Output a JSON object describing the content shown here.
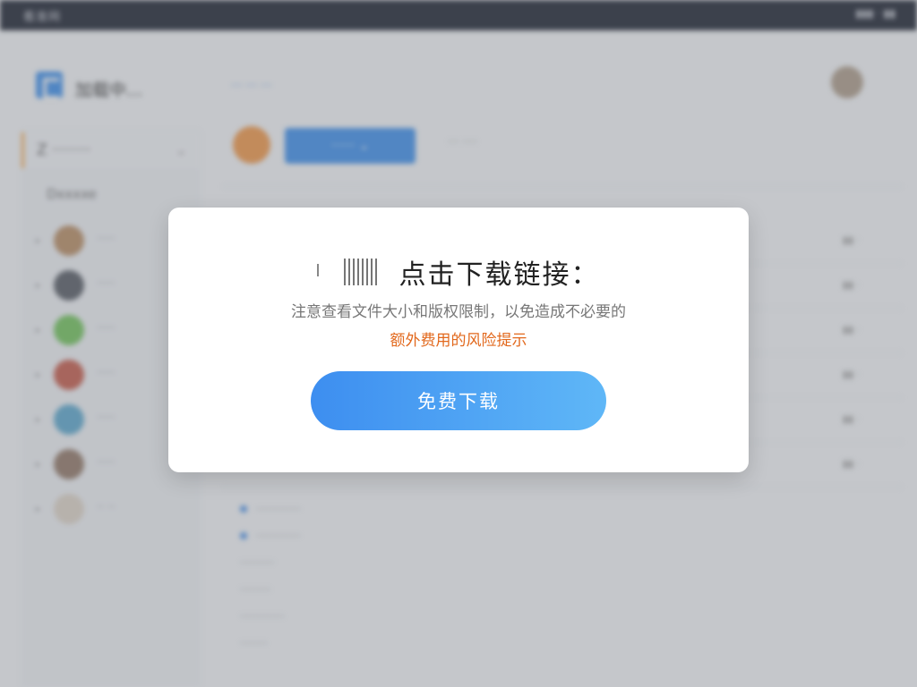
{
  "background": {
    "topbar": {
      "brand": "看准网",
      "right": "▮▮▮ · ▮▮"
    },
    "header": {
      "team_name": "加载中...",
      "link": "··· ··· ···"
    },
    "workspace": {
      "label": "Z ········",
      "chevron": "⌄"
    },
    "sidebar_section": "Dxxxxe",
    "members": [
      {
        "name": "·····",
        "color": "#b48a62"
      },
      {
        "name": "·····",
        "color": "#555a63"
      },
      {
        "name": "·····",
        "color": "#6fbf5a"
      },
      {
        "name": "·····",
        "color": "#c15a4a"
      },
      {
        "name": "·····",
        "color": "#5aa4c9"
      },
      {
        "name": "·····",
        "color": "#8f7666"
      },
      {
        "name": "·· ··",
        "color": "#d9d0c4"
      }
    ],
    "main": {
      "primary_button": "······ ⌄",
      "search_hint": "··· ····",
      "rows": [
        "▮▮ ·",
        "▮▮ ·",
        "▮▮ ·",
        "▮▮ ·",
        "▮▮ ·",
        "▮▮ ·"
      ],
      "lower_rows": [
        "·············",
        "·············",
        "··········",
        "·········",
        "·············",
        "········"
      ]
    }
  },
  "modal": {
    "title": "点击下载链接：",
    "description": "注意查看文件大小和版权限制，以免造成不必要的",
    "warning": "额外费用的风险提示",
    "download_button": "免费下载",
    "icon": "qr-code-icon"
  },
  "colors": {
    "accent": "#3c8ce6",
    "warning": "#e2681c",
    "button_gradient_start": "#3d8ef0",
    "button_gradient_end": "#5fb7f7"
  }
}
